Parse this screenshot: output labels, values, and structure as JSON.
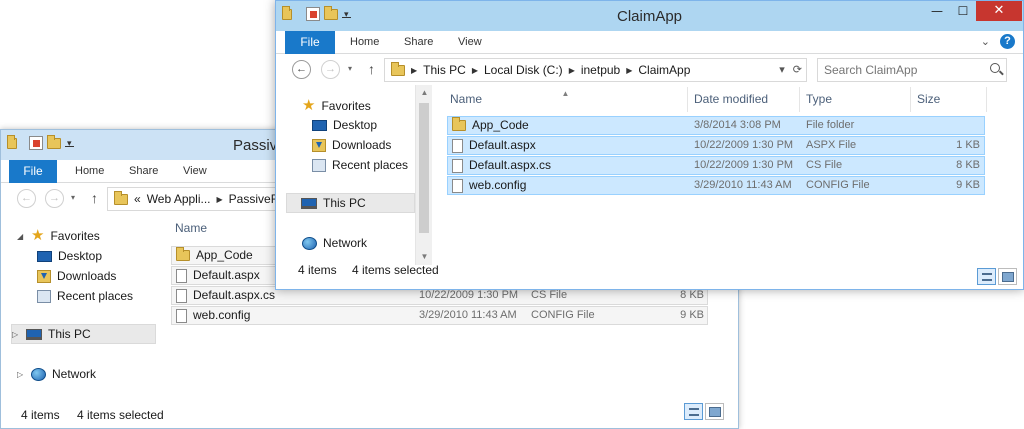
{
  "back_window": {
    "title": "PassiveR",
    "ribbon_tabs": [
      "File",
      "Home",
      "Share",
      "View"
    ],
    "address_crumbs": [
      "«",
      "Web Appli...",
      "PassiveRe"
    ],
    "nav_items": [
      "Favorites",
      "Desktop",
      "Downloads",
      "Recent places",
      "This PC",
      "Network"
    ],
    "columns": [
      "Name"
    ],
    "files": [
      {
        "name": "App_Code",
        "date": "",
        "type": "",
        "size": ""
      },
      {
        "name": "Default.aspx",
        "date": "",
        "type": "",
        "size": ""
      },
      {
        "name": "Default.aspx.cs",
        "date": "10/22/2009 1:30 PM",
        "type": "CS File",
        "size": "8 KB"
      },
      {
        "name": "web.config",
        "date": "3/29/2010 11:43 AM",
        "type": "CONFIG File",
        "size": "9 KB"
      }
    ],
    "status": {
      "count": "4 items",
      "selected": "4 items selected"
    }
  },
  "front_window": {
    "title": "ClaimApp",
    "ribbon_tabs": [
      "File",
      "Home",
      "Share",
      "View"
    ],
    "window_buttons": {
      "minimize": "—",
      "maximize": "☐",
      "close": "✕"
    },
    "ribbon_help": "?",
    "ribbon_expand": "⌄",
    "nav": {
      "back": "←",
      "forward": "→",
      "dropdown": "▾",
      "up": "↑",
      "refresh": "⟳",
      "address_dropdown": "▾"
    },
    "address_crumbs": [
      "This PC",
      "Local Disk (C:)",
      "inetpub",
      "ClaimApp"
    ],
    "search_placeholder": "Search ClaimApp",
    "nav_items": [
      "Favorites",
      "Desktop",
      "Downloads",
      "Recent places",
      "This PC",
      "Network"
    ],
    "columns": [
      "Name",
      "Date modified",
      "Type",
      "Size"
    ],
    "files": [
      {
        "name": "App_Code",
        "date": "3/8/2014 3:08 PM",
        "type": "File folder",
        "size": "",
        "icon": "folder-icon"
      },
      {
        "name": "Default.aspx",
        "date": "10/22/2009 1:30 PM",
        "type": "ASPX File",
        "size": "1 KB",
        "icon": "file-icon"
      },
      {
        "name": "Default.aspx.cs",
        "date": "10/22/2009 1:30 PM",
        "type": "CS File",
        "size": "8 KB",
        "icon": "file-icon"
      },
      {
        "name": "web.config",
        "date": "3/29/2010 11:43 AM",
        "type": "CONFIG File",
        "size": "9 KB",
        "icon": "file-icon"
      }
    ],
    "status": {
      "count": "4 items",
      "selected": "4 items selected"
    }
  },
  "colors": {
    "file_tab": "#1979ca",
    "selection": "#cce8ff",
    "selection_border": "#99d1ff",
    "titlebar": "#aed6f1",
    "close": "#c7362f"
  }
}
